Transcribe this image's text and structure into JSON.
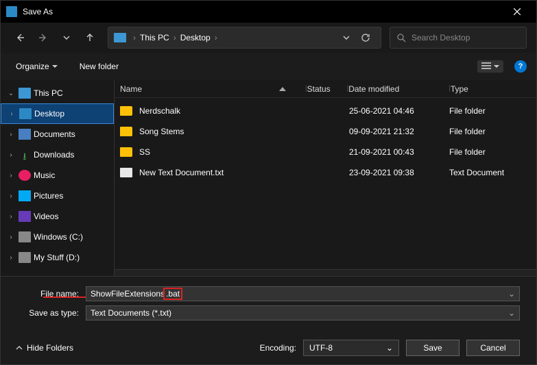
{
  "titlebar": {
    "title": "Save As"
  },
  "nav": {
    "address": {
      "root": "This PC",
      "current": "Desktop"
    },
    "search_placeholder": "Search Desktop"
  },
  "toolbar": {
    "organize": "Organize",
    "newfolder": "New folder"
  },
  "sidebar": {
    "items": [
      {
        "id": "thispc",
        "label": "This PC",
        "expanded": true
      },
      {
        "id": "desktop",
        "label": "Desktop",
        "selected": true
      },
      {
        "id": "documents",
        "label": "Documents"
      },
      {
        "id": "downloads",
        "label": "Downloads"
      },
      {
        "id": "music",
        "label": "Music"
      },
      {
        "id": "pictures",
        "label": "Pictures"
      },
      {
        "id": "videos",
        "label": "Videos"
      },
      {
        "id": "windowsc",
        "label": "Windows (C:)"
      },
      {
        "id": "mystuffd",
        "label": "My Stuff (D:)"
      }
    ]
  },
  "columns": {
    "name": "Name",
    "status": "Status",
    "date": "Date modified",
    "type": "Type"
  },
  "files": [
    {
      "name": "Nerdschalk",
      "date": "25-06-2021 04:46",
      "type": "File folder",
      "kind": "folder"
    },
    {
      "name": "Song Stems",
      "date": "09-09-2021 21:32",
      "type": "File folder",
      "kind": "folder"
    },
    {
      "name": "SS",
      "date": "21-09-2021 00:43",
      "type": "File folder",
      "kind": "folder"
    },
    {
      "name": "New Text Document.txt",
      "date": "23-09-2021 09:38",
      "type": "Text Document",
      "kind": "txt"
    }
  ],
  "form": {
    "filename_label": "File name:",
    "filename_base": "ShowFileExtensions",
    "filename_ext": ".bat",
    "saveastype_label": "Save as type:",
    "saveastype_value": "Text Documents (*.txt)"
  },
  "footer": {
    "hide": "Hide Folders",
    "encoding_label": "Encoding:",
    "encoding_value": "UTF-8",
    "save": "Save",
    "cancel": "Cancel"
  }
}
